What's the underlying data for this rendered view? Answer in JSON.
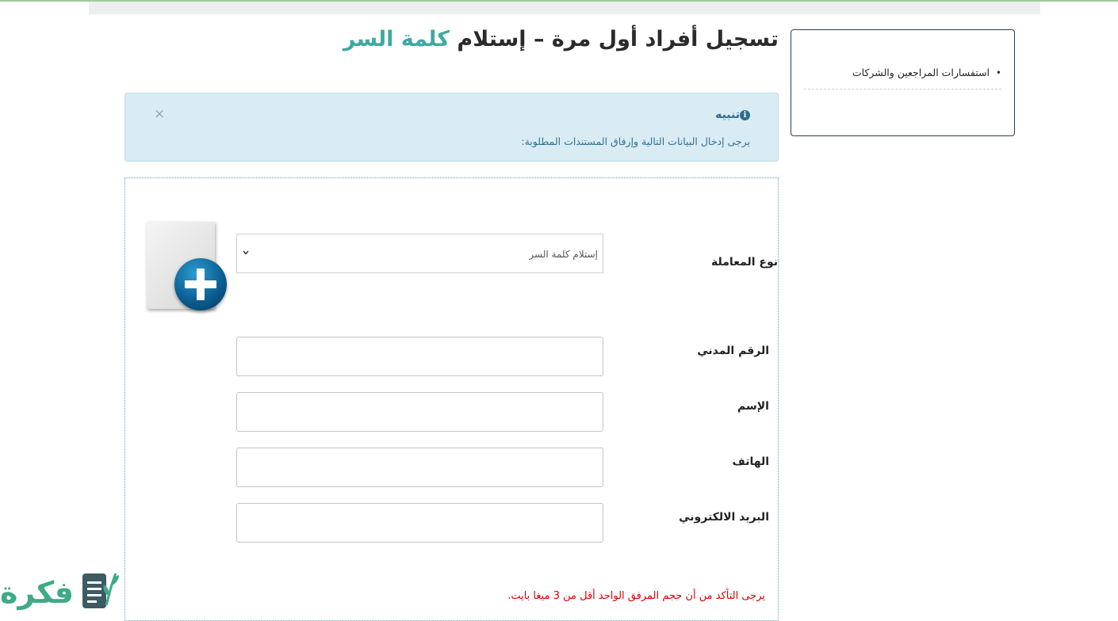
{
  "page_title": {
    "main": "تسجيل أفراد أول مرة – إستلام",
    "accent": "كلمة السر"
  },
  "sidebar": {
    "items": [
      {
        "label": "استفسارات المراجعين والشركات"
      }
    ]
  },
  "alert": {
    "title": "تنبيه",
    "text": "يرجى إدخال البيانات التالية وإرفاق المستندات المطلوبة:",
    "close": "×"
  },
  "form": {
    "transaction_type": {
      "label": "نوع المعاملة",
      "value": "إستلام كلمة السر"
    },
    "civil_id": {
      "label": "الرقم المدني",
      "value": ""
    },
    "name": {
      "label": "الإسم",
      "value": ""
    },
    "phone": {
      "label": "الهاتف",
      "value": ""
    },
    "email": {
      "label": "البريد الالكتروني",
      "value": ""
    },
    "note": "يرجى التأكد من أن حجم المرفق الواحد أقل من 3 ميغا بايت."
  },
  "logo": {
    "text": "فكرة"
  },
  "colors": {
    "accent": "#3fa9a1",
    "alert_bg": "#d9ecf4",
    "warning": "#e00000",
    "logo": "#3eaa87"
  }
}
